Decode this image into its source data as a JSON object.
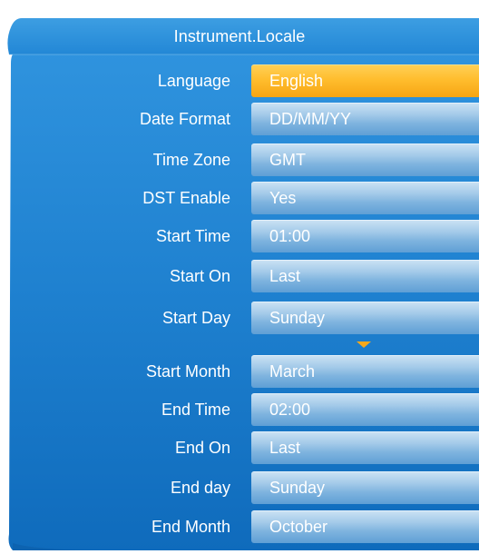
{
  "title": "Instrument.Locale",
  "colors": {
    "panel_top": "#2a8fdc",
    "panel_bottom": "#0e6bbd",
    "field": "#8dbde3",
    "selected": "#fdb727",
    "arrow": "#f7a81b"
  },
  "rows": [
    {
      "label": "Language",
      "value": "English",
      "selected": true
    },
    {
      "label": "Date Format",
      "value": "DD/MM/YY",
      "selected": false
    },
    {
      "label": "Time Zone",
      "value": "GMT",
      "selected": false
    },
    {
      "label": "DST Enable",
      "value": "Yes",
      "selected": false
    },
    {
      "label": "Start Time",
      "value": "01:00",
      "selected": false
    },
    {
      "label": "Start On",
      "value": "Last",
      "selected": false
    },
    {
      "label": "Start Day",
      "value": "Sunday",
      "selected": false
    },
    {
      "label": "Start Month",
      "value": "March",
      "selected": false
    },
    {
      "label": "End Time",
      "value": "02:00",
      "selected": false
    },
    {
      "label": "End On",
      "value": "Last",
      "selected": false
    },
    {
      "label": "End day",
      "value": "Sunday",
      "selected": false
    },
    {
      "label": "End Month",
      "value": "October",
      "selected": false
    }
  ],
  "scroll_icon": "triangle-down"
}
